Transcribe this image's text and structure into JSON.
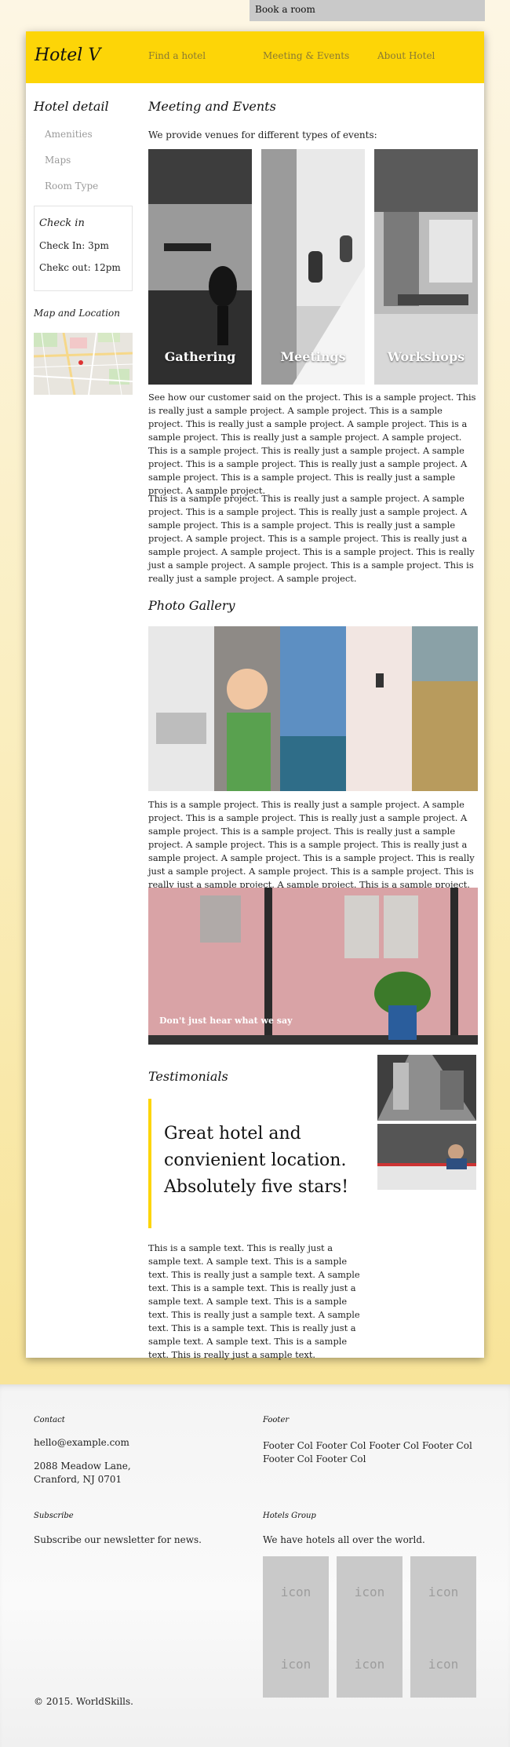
{
  "topbar": {
    "book_label": "Book a room"
  },
  "header": {
    "brand": "Hotel V",
    "nav": [
      "Find a hotel",
      "Meeting & Events",
      "About Hotel"
    ]
  },
  "sidebar": {
    "title": "Hotel detail",
    "links": [
      "Amenities",
      "Maps",
      "Room Type"
    ],
    "checkin": {
      "title": "Check in",
      "check_in": "Check In: 3pm",
      "check_out": "Chekc out: 12pm"
    },
    "map_title": "Map and Location"
  },
  "main": {
    "events_title": "Meeting and Events",
    "events_intro": "We provide venues for different types of events:",
    "venues": [
      "Gathering",
      "Meetings",
      "Workshops"
    ],
    "para1": "See how our customer said on the project. This is a sample project. This is really just a sample project. A sample project. This is a sample project. This is really just a sample project. A sample project. This is a sample project. This is really just a sample project. A sample project. This is a sample project. This is really just a sample project. A sample project. This is a sample project. This is really just a sample project. A sample project. This is a sample project. This is really just a sample project. A sample project.",
    "para2": "This is a sample project. This is really just a sample project. A sample project. This is a sample project. This is really just a sample project. A sample project. This is a sample project. This is really just a sample project. A sample project. This is a sample project. This is really just a sample project. A sample project. This is a sample project. This is really just a sample project. A sample project. This is a sample project. This is really just a sample project. A sample project.",
    "gallery_title": "Photo Gallery",
    "para3": "This is a sample project. This is really just a sample project. A sample project. This is a sample project. This is really just a sample project. A sample project. This is a sample project. This is really just a sample project. A sample project. This is a sample project. This is really just a sample project. A sample project. This is a sample project. This is really just a sample project. A sample project. This is a sample project. This is really just a sample project. A sample project. This is a sample project. This is really just a sample project. A sample project.",
    "banner_caption": "Don't just hear what we say",
    "testimonials_title": "Testimonials",
    "quote": "Great hotel and convienient location. Absolutely five stars!",
    "testimonial_text": "This is a sample text. This is really just a sample text. A sample text. This is a sample text. This is really just a sample text. A sample text. This is a sample text. This is really just a sample text. A sample text. This is a sample text. This is really just a sample text. A sample text. This is a sample text. This is really just a sample text. A sample text. This is a sample text. This is really just a sample text."
  },
  "footer": {
    "contact_title": "Contact",
    "email": "hello@example.com",
    "address_line1": "2088 Meadow Lane,",
    "address_line2": "Cranford, NJ 0701",
    "footer_title": "Footer",
    "footer_text": "Footer Col Footer Col Footer Col Footer Col Footer Col Footer Col",
    "subscribe_title": "Subscribe",
    "subscribe_text": "Subscribe our newsletter for news.",
    "group_title": "Hotels Group",
    "group_text": "We have hotels all over the world.",
    "icon_label": "icon",
    "copyright": "© 2015. WorldSkills."
  }
}
